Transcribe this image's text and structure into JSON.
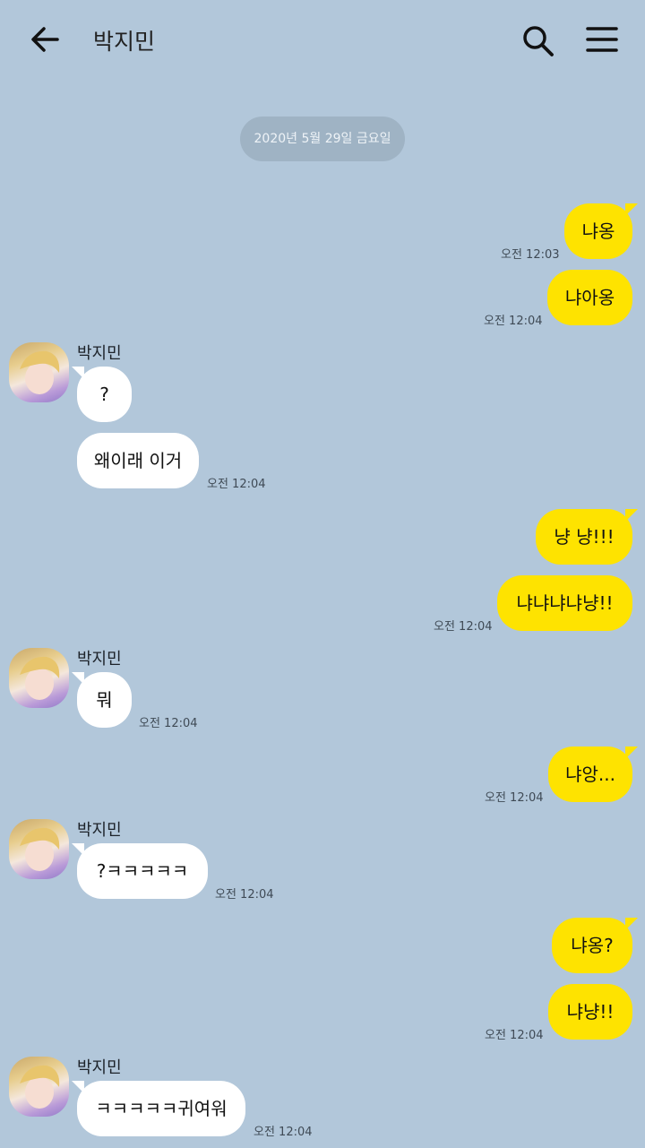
{
  "header": {
    "title": "박지민"
  },
  "date_divider": "2020년 5월 29일 금요일",
  "sender_name": "박지민",
  "messages": [
    {
      "side": "me",
      "text": "냐옹",
      "time": "오전 12:03"
    },
    {
      "side": "me",
      "text": "냐아옹",
      "time": "오전 12:04"
    },
    {
      "side": "you",
      "text": "?",
      "time": ""
    },
    {
      "side": "you",
      "text": "왜이래 이거",
      "time": "오전 12:04"
    },
    {
      "side": "me",
      "text": "냥 냥!!!",
      "time": ""
    },
    {
      "side": "me",
      "text": "냐냐냐냐냥!!",
      "time": "오전 12:04"
    },
    {
      "side": "you",
      "text": "뭐",
      "time": "오전 12:04"
    },
    {
      "side": "me",
      "text": "냐앙...",
      "time": "오전 12:04"
    },
    {
      "side": "you",
      "text": "?ㅋㅋㅋㅋㅋ",
      "time": "오전 12:04"
    },
    {
      "side": "me",
      "text": "냐옹?",
      "time": ""
    },
    {
      "side": "me",
      "text": "냐냥!!",
      "time": "오전 12:04"
    },
    {
      "side": "you",
      "text": "ㅋㅋㅋㅋㅋ귀여워",
      "time": "오전 12:04"
    }
  ],
  "colors": {
    "background": "#b2c7da",
    "my_bubble": "#fee300",
    "their_bubble": "#ffffff"
  }
}
